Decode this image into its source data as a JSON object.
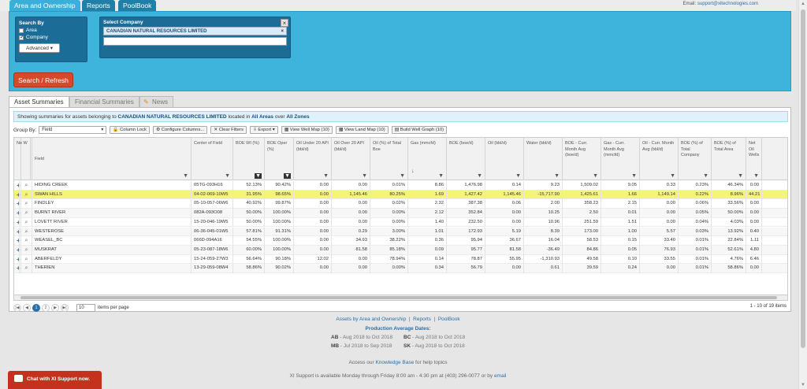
{
  "top_tabs": [
    "Area and Ownership",
    "Reports",
    "PoolBook"
  ],
  "email": {
    "label": "Email:",
    "address": "support@xitechnologies.com"
  },
  "search_by": {
    "title": "Search By",
    "area_label": "Area",
    "company_label": "Company",
    "advanced_label": "Advanced ▾"
  },
  "select_company": {
    "title": "Select Company",
    "selected": "CANADIAN NATURAL RESOURCES LIMITED",
    "chip_remove": "×",
    "close": "×"
  },
  "search_button": "Search / Refresh",
  "content_tabs": [
    "Asset Summaries",
    "Financial Summaries",
    "News"
  ],
  "info": {
    "prefix": "Showing summaries for assets belonging to",
    "company": "CANADIAN NATURAL RESOURCES LIMITED",
    "mid": "located in",
    "area": "All Areas",
    "mid2": "over",
    "zones": "All Zones"
  },
  "toolbar": {
    "group_by_label": "Group By:",
    "group_by_value": "Field",
    "buttons": [
      "Column Lock",
      "Configure Columns...",
      "Clear Filters",
      "Export ▾",
      "View Well Map (10)",
      "View Land Map (10)",
      "Build Well Graph (10)"
    ]
  },
  "grid": {
    "headers": [
      "Field",
      "Center of Field",
      "BOE WI (%)",
      "BOE Oper (%)",
      "Oil Under 20 API (bbl/d)",
      "Oil Over 20 API (bbl/d)",
      "Oil (%) of Total Boe",
      "Gas (mmcfd)",
      "BOE (boe/d)",
      "Oil (bbl/d)",
      "Water (bbl/d)",
      "BOE - Curr. Month Avg (boe/d)",
      "Gas - Curr. Month Avg (mmcfd)",
      "Oil - Curr. Month Avg (bbl/d)",
      "BOE (%) of Total Company",
      "BOE (%) of Total Area",
      "Net Oil Wells",
      "Ne W"
    ],
    "rows": [
      [
        "HIDING CREEK",
        "05TG-093H16",
        "52.13%",
        "90.42%",
        "0.00",
        "0.00",
        "0.01%",
        "8.86",
        "1,476.98",
        "0.14",
        "9.23",
        "1,509.02",
        "9.05",
        "0.33",
        "0.23%",
        "46.34%",
        "0.00",
        ""
      ],
      [
        "SWAN HILLS",
        "04-02-069-10W5",
        "31.95%",
        "98.65%",
        "0.00",
        "1,145.46",
        "80.25%",
        "1.69",
        "1,427.42",
        "1,145.46",
        "-15,717.90",
        "1,425.61",
        "1.66",
        "1,149.14",
        "0.22%",
        "8.96%",
        "44.21",
        ""
      ],
      [
        "FINDLEY",
        "05-10-057-06W6",
        "40.92%",
        "99.87%",
        "0.00",
        "0.00",
        "0.02%",
        "2.32",
        "387.38",
        "0.06",
        "2.00",
        "358.23",
        "2.15",
        "0.00",
        "0.06%",
        "33.56%",
        "0.00",
        ""
      ],
      [
        "BURNT RIVER",
        "082A-093O08",
        "50.00%",
        "100.00%",
        "0.00",
        "0.00",
        "0.00%",
        "2.12",
        "352.84",
        "0.00",
        "10.25",
        "2.50",
        "0.01",
        "0.00",
        "0.05%",
        "50.00%",
        "0.00",
        ""
      ],
      [
        "LOVETT RIVER",
        "15-20-046-19W5",
        "50.00%",
        "100.00%",
        "0.00",
        "0.00",
        "0.00%",
        "1.40",
        "232.50",
        "0.00",
        "10.96",
        "251.59",
        "1.51",
        "0.00",
        "0.04%",
        "4.03%",
        "0.00",
        ""
      ],
      [
        "WESTEROSE",
        "06-36-045-01W5",
        "57.81%",
        "91.31%",
        "0.00",
        "0.29",
        "3.00%",
        "1.01",
        "172.93",
        "5.19",
        "8.39",
        "173.00",
        "1.00",
        "5.57",
        "0.03%",
        "13.92%",
        "0.40",
        ""
      ],
      [
        "WEASEL_BC",
        "066D-094A16",
        "54.55%",
        "100.00%",
        "0.00",
        "34.93",
        "38.22%",
        "0.36",
        "95.94",
        "36.67",
        "16.04",
        "58.53",
        "0.15",
        "33.40",
        "0.01%",
        "22.84%",
        "1.11",
        ""
      ],
      [
        "MUSKRAT",
        "05-23-087-18W6",
        "60.00%",
        "100.00%",
        "0.00",
        "81.58",
        "85.18%",
        "0.09",
        "95.77",
        "81.58",
        "-36.49",
        "84.86",
        "0.05",
        "76.93",
        "0.01%",
        "52.61%",
        "4.80",
        ""
      ],
      [
        "ABERFELDY",
        "15-24-059-27W3",
        "56.64%",
        "90.18%",
        "12.02",
        "0.00",
        "78.94%",
        "0.14",
        "78.87",
        "55.95",
        "-1,310.93",
        "49.58",
        "0.10",
        "33.55",
        "0.01%",
        "4.76%",
        "6.46",
        ""
      ],
      [
        "THERIEN",
        "13-29-059-08W4",
        "58.86%",
        "90.02%",
        "0.00",
        "0.00",
        "0.00%",
        "0.34",
        "56.79",
        "0.00",
        "0.61",
        "39.59",
        "0.24",
        "0.00",
        "0.01%",
        "58.86%",
        "0.00",
        ""
      ]
    ]
  },
  "pager": {
    "pages": [
      "1",
      "2"
    ],
    "page_size": "10",
    "per_page_label": "items per page",
    "info": "1 - 10 of 19 items"
  },
  "footer": {
    "links": [
      "Assets by Area and Ownership",
      "Reports",
      "PoolBook"
    ],
    "prod_title": "Production Average Dates:",
    "dates": [
      {
        "code": "AB",
        "range": "- Aug 2018 to Oct 2018"
      },
      {
        "code": "BC",
        "range": "- Aug 2018 to Oct 2018"
      },
      {
        "code": "MB",
        "range": "- Jul 2018 to Sep 2018"
      },
      {
        "code": "SK",
        "range": "- Aug 2018 to Oct 2018"
      }
    ],
    "kb_prefix": "Access our",
    "kb_link": "Knowledge Base",
    "kb_suffix": "for help topics",
    "support_text": "XI Support is available Monday through Friday 8:00 am - 4:30 pm at (403) 296-0077 or by",
    "support_link": "email"
  },
  "chat_button": "Chat with XI Support now."
}
